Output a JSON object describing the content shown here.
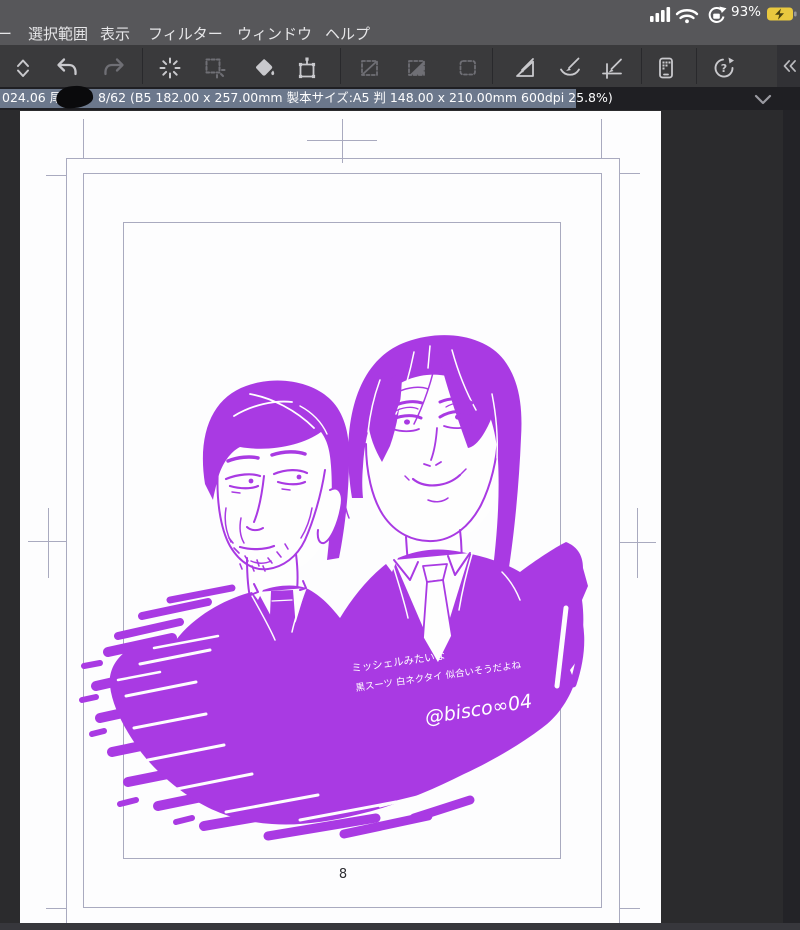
{
  "status_bar": {
    "battery_percent": "93%",
    "icons": [
      "signal-bars",
      "wifi",
      "rotation-lock",
      "battery-charging"
    ]
  },
  "menu_bar": {
    "items": [
      "ー",
      "選択範囲",
      "表示",
      "フィルター",
      "ウィンドウ",
      "ヘルプ"
    ]
  },
  "toolbar": {
    "icons": [
      "collapse-toolbar",
      "undo",
      "redo",
      "deselect",
      "reselect",
      "fill",
      "transform-frame",
      "invert-selection",
      "selection-launcher",
      "selection-rect",
      "snap-to-ruler",
      "snap-to-special-ruler",
      "snap-to-grid",
      "companion-mode",
      "help"
    ],
    "right_collapse": "collapse-panel"
  },
  "title_bar": {
    "title_left": "024.06 尾鯉",
    "title_right": "8/62 (B5 182.00 x 257.00mm 製本サイズ:A5 判 148.00 x 210.00mm 600dpi 25.8%)"
  },
  "page": {
    "number": "8"
  },
  "artwork": {
    "note_line1": "ミッシェルみたいな",
    "note_line2": "黒スーツ 白ネクタイ 似合いそうだよね",
    "signature": "@bisco∞04",
    "ink_color": "#a93ae3"
  },
  "colors": {
    "ink": "#a93ae3",
    "selection_highlight": "#6c788c",
    "battery_low_power": "#e9c83f",
    "canvas_bg": "#2b2b2d"
  }
}
